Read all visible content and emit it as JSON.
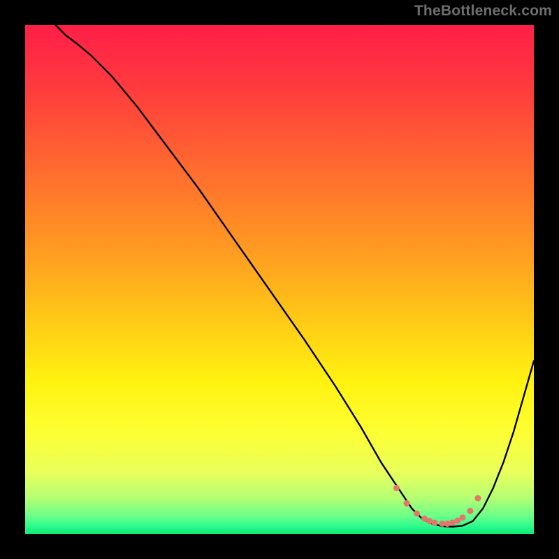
{
  "chart_data": {
    "type": "line",
    "title": "",
    "xlabel": "",
    "ylabel": "",
    "watermark": "TheBottleneck.com",
    "xlim": [
      0,
      100
    ],
    "ylim": [
      0,
      100
    ],
    "legend": false,
    "grid": false,
    "background_gradient": [
      {
        "offset": 0.0,
        "color": "#ff1f48"
      },
      {
        "offset": 0.12,
        "color": "#ff3a3e"
      },
      {
        "offset": 0.28,
        "color": "#ff6a2f"
      },
      {
        "offset": 0.44,
        "color": "#ff9a22"
      },
      {
        "offset": 0.58,
        "color": "#ffc916"
      },
      {
        "offset": 0.7,
        "color": "#fff210"
      },
      {
        "offset": 0.8,
        "color": "#fdff33"
      },
      {
        "offset": 0.88,
        "color": "#e8ff5c"
      },
      {
        "offset": 0.93,
        "color": "#b3ff73"
      },
      {
        "offset": 0.965,
        "color": "#6bff8a"
      },
      {
        "offset": 0.985,
        "color": "#2bfc8d"
      },
      {
        "offset": 1.0,
        "color": "#0fe978"
      }
    ],
    "series": [
      {
        "name": "bottleneck-curve",
        "color": "#000000",
        "x": [
          6,
          8,
          10,
          13,
          17,
          22,
          28,
          34,
          41,
          48,
          55,
          61,
          66,
          70,
          74,
          76,
          78,
          80,
          82,
          84,
          86,
          88,
          90,
          92,
          94,
          96,
          98,
          100
        ],
        "y": [
          100,
          98,
          96.5,
          94,
          90,
          84,
          76,
          68,
          58,
          48,
          38,
          29,
          21,
          14,
          8,
          5,
          3,
          2,
          1.5,
          1.4,
          1.6,
          2.5,
          5,
          9,
          14,
          20,
          27,
          34
        ]
      }
    ],
    "highlight_points": {
      "color": "#e5766c",
      "radius_px": 4.5,
      "x": [
        73,
        75,
        77,
        78.5,
        79.5,
        80.5,
        82,
        83,
        84,
        85,
        86,
        87.5,
        89
      ],
      "y": [
        9,
        6,
        4,
        3,
        2.5,
        2.2,
        2.0,
        2.0,
        2.2,
        2.6,
        3.2,
        4.5,
        7
      ]
    }
  }
}
